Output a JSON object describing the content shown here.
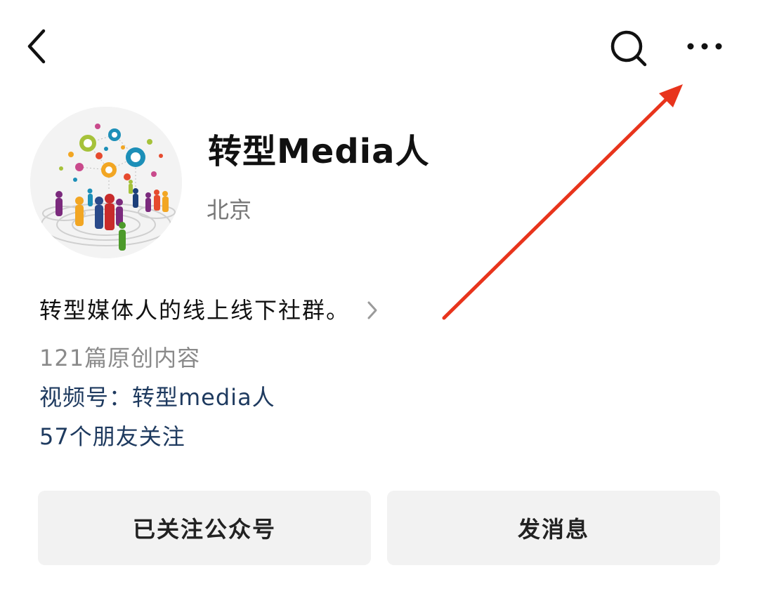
{
  "header": {
    "back_icon": "chevron-left-icon",
    "search_icon": "search-icon",
    "more_icon": "more-horizontal-icon"
  },
  "profile": {
    "name": "转型Media人",
    "location": "北京",
    "description": "转型媒体人的线上线下社群。",
    "article_count": "121篇原创内容",
    "channels": "视频号：转型media人",
    "friends_following": "57个朋友关注"
  },
  "actions": {
    "follow_label": "已关注公众号",
    "message_label": "发消息"
  },
  "colors": {
    "link": "#1e3a5f",
    "secondary_text": "#8a8a8a",
    "button_bg": "#f2f2f2",
    "annotation_arrow": "#e8341c"
  }
}
